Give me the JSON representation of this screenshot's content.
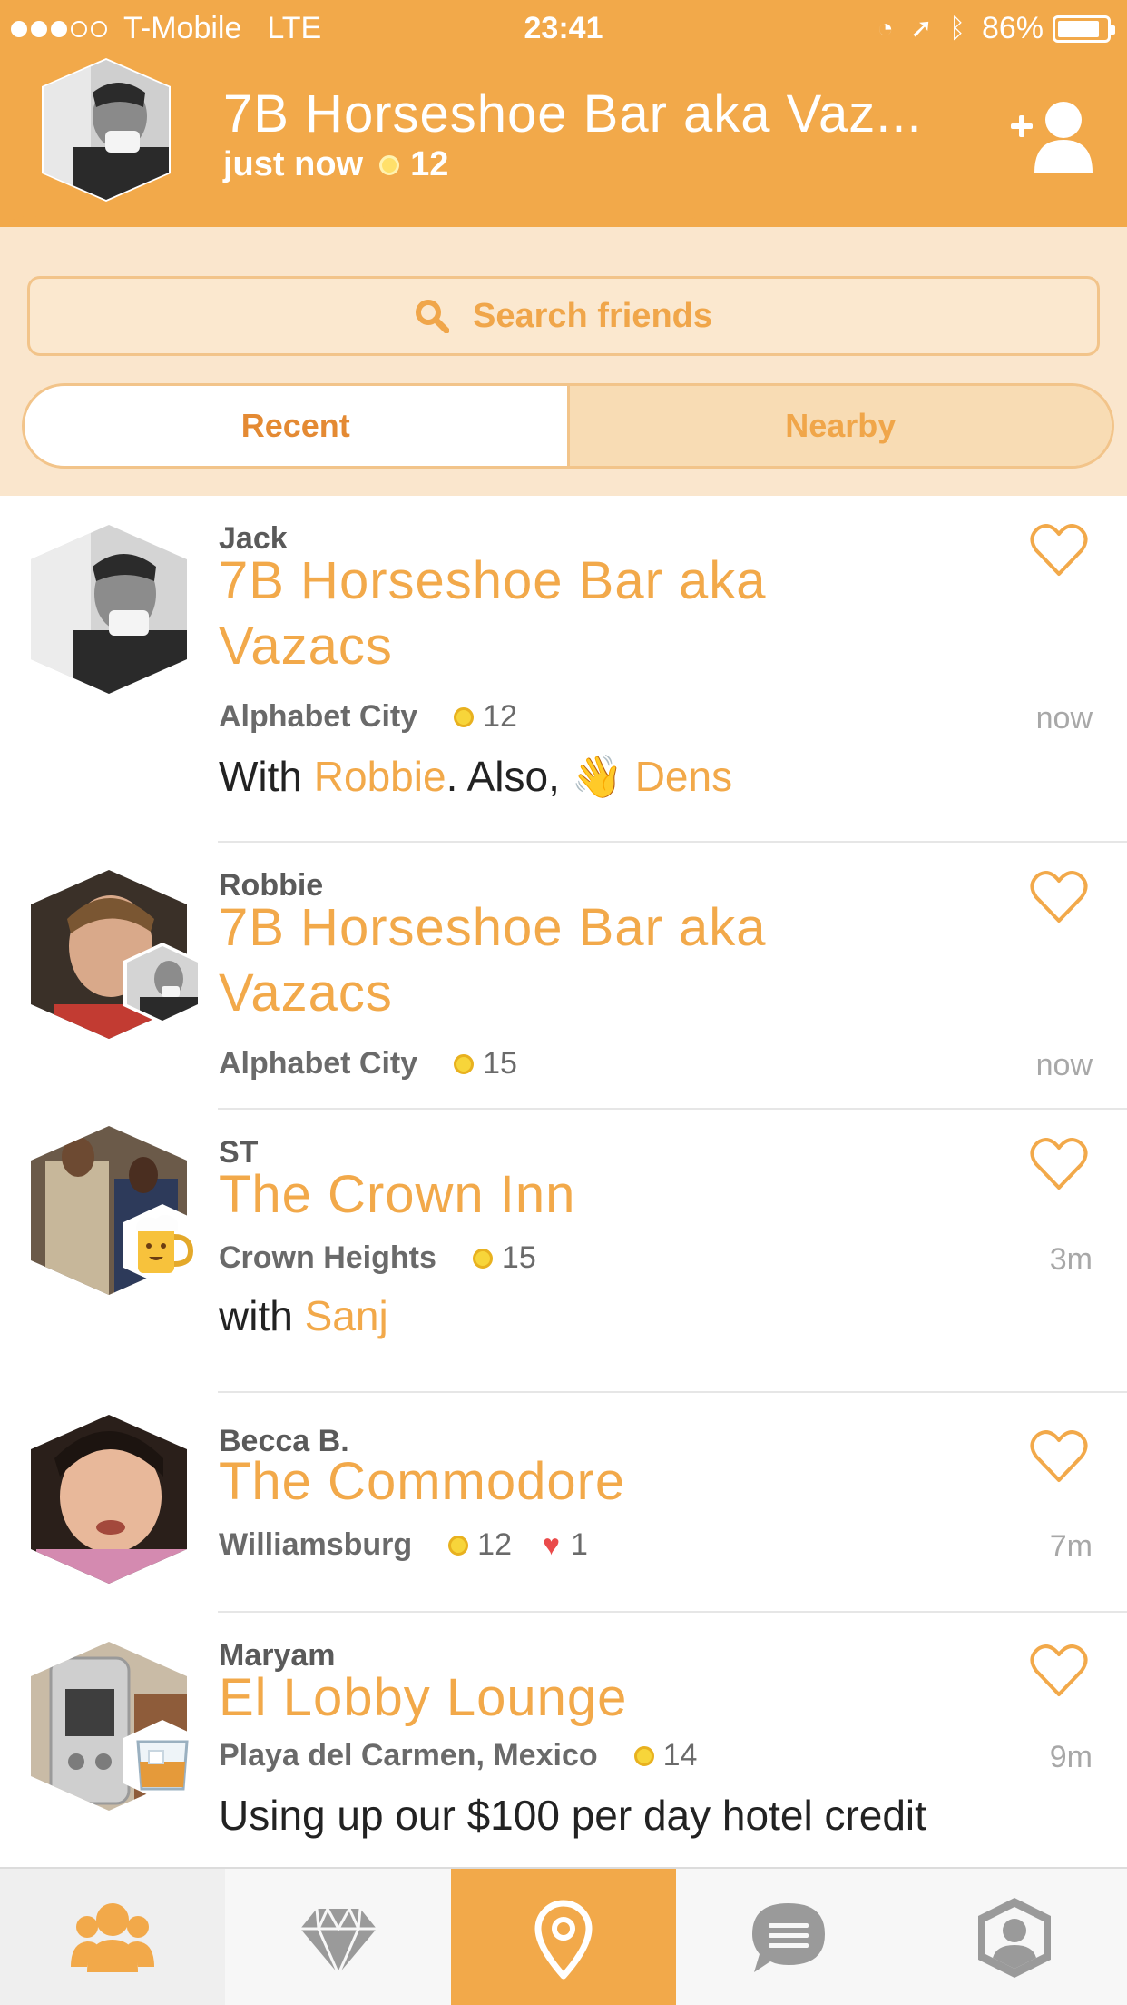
{
  "status_bar": {
    "carrier": "T-Mobile",
    "network": "LTE",
    "time": "23:41",
    "battery": "86%"
  },
  "header": {
    "title": "7B Horseshoe Bar aka Vaz...",
    "subtitle_time": "just now",
    "subtitle_coins": "12"
  },
  "search": {
    "placeholder": "Search friends"
  },
  "tabs": {
    "recent": "Recent",
    "nearby": "Nearby"
  },
  "feed": [
    {
      "name": "Jack",
      "venue_line1": "7B Horseshoe Bar aka",
      "venue_line2": "Vazacs",
      "neighborhood": "Alphabet City",
      "coins": "12",
      "time": "now",
      "note_parts": [
        "With ",
        "Robbie",
        ". Also, ",
        "👋",
        " Dens"
      ]
    },
    {
      "name": "Robbie",
      "venue_line1": "7B Horseshoe Bar aka",
      "venue_line2": "Vazacs",
      "neighborhood": "Alphabet City",
      "coins": "15",
      "time": "now"
    },
    {
      "name": "ST",
      "venue_line1": "The Crown Inn",
      "neighborhood": "Crown Heights",
      "coins": "15",
      "time": "3m",
      "note_parts": [
        "with ",
        "Sanj"
      ]
    },
    {
      "name": "Becca B.",
      "venue_line1": "The Commodore",
      "neighborhood": "Williamsburg",
      "coins": "12",
      "likes": "1",
      "time": "7m"
    },
    {
      "name": "Maryam",
      "venue_line1": "El Lobby Lounge",
      "neighborhood": "Playa del Carmen, Mexico",
      "coins": "14",
      "time": "9m",
      "note": "Using up our $100 per day hotel credit"
    }
  ],
  "tabbar": [
    "friends-icon",
    "diamond-icon",
    "check-in-icon",
    "messages-icon",
    "profile-icon"
  ],
  "colors": {
    "accent": "#f2a94a",
    "accent_dark": "#e48a33",
    "controls_bg": "#fae6cd",
    "coin": "#f7d53a",
    "heart": "#ea4b4b"
  }
}
